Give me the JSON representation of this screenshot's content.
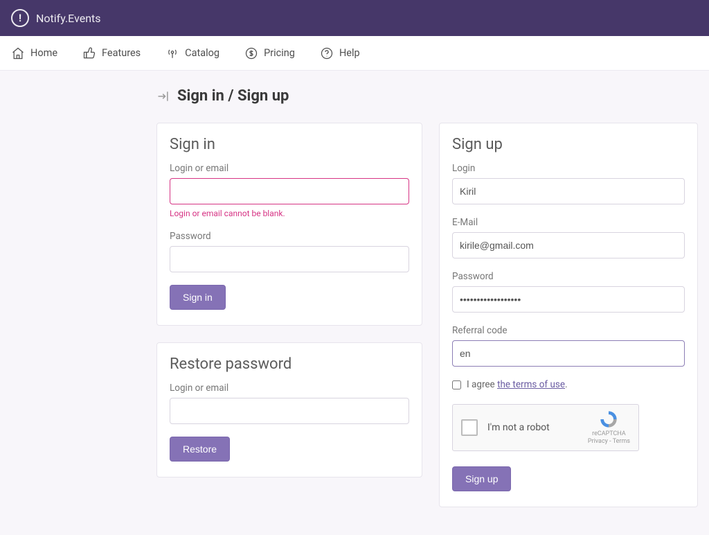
{
  "brand": "Notify.Events",
  "nav": {
    "items": [
      {
        "label": "Home"
      },
      {
        "label": "Features"
      },
      {
        "label": "Catalog"
      },
      {
        "label": "Pricing"
      },
      {
        "label": "Help"
      }
    ]
  },
  "page": {
    "title": "Sign in / Sign up"
  },
  "signin": {
    "title": "Sign in",
    "login_label": "Login or email",
    "login_value": "",
    "login_error": "Login or email cannot be blank.",
    "password_label": "Password",
    "password_value": "",
    "submit": "Sign in"
  },
  "restore": {
    "title": "Restore password",
    "login_label": "Login or email",
    "login_value": "",
    "submit": "Restore"
  },
  "signup": {
    "title": "Sign up",
    "login_label": "Login",
    "login_value": "Kiril",
    "email_label": "E-Mail",
    "email_value": "kirile@gmail.com",
    "password_label": "Password",
    "password_value": "••••••••••••••••••",
    "referral_label": "Referral code",
    "referral_value": "en",
    "agree_prefix": "I agree ",
    "agree_link": "the terms of use",
    "agree_suffix": ".",
    "agree_checked": false,
    "submit": "Sign up"
  },
  "recaptcha": {
    "label": "I'm not a robot",
    "brand": "reCAPTCHA",
    "meta": "Privacy - Terms"
  }
}
